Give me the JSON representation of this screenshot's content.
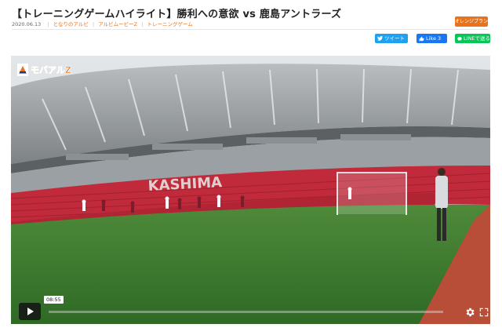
{
  "header": {
    "title": "【トレーニングゲームハイライト】勝利への意欲 vs 鹿島アントラーズ",
    "date": "2020.06.13",
    "categories": [
      "となりのアルビ",
      "アルビムービーZ",
      "トレーニングゲーム"
    ],
    "badge": "オレンジプラン"
  },
  "share": {
    "tweet_label": "ツイート",
    "like_label": "Like 3",
    "line_label": "LINEで送る"
  },
  "video": {
    "watermark": "モバアルZ",
    "stadium_text": "KASHIMA",
    "time_tooltip": "08:55",
    "progress_fraction": 0.0,
    "colors": {
      "accent": "#e8731d",
      "twitter": "#1da1f2",
      "facebook": "#1877f2",
      "line": "#06c755"
    }
  },
  "icons": {
    "play": "play-icon",
    "settings": "gear-icon",
    "fullscreen": "fullscreen-icon"
  }
}
